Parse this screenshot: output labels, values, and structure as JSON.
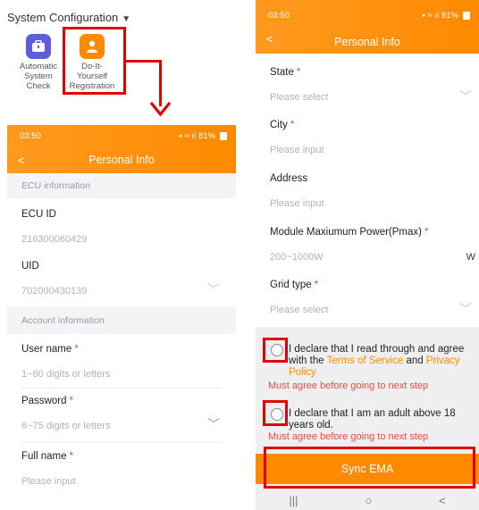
{
  "top": {
    "section_title": "System Configuration",
    "tiles": [
      {
        "label": "Automatic System Check",
        "icon": "briefcase-icon"
      },
      {
        "label": "Do-It-Yourself Registration",
        "icon": "person-icon"
      }
    ]
  },
  "left_phone": {
    "status": {
      "time": "03:50",
      "battery": "81%"
    },
    "nav": {
      "title": "Personal Info",
      "back": "<"
    },
    "ecu_section": "ECU information",
    "ecu_id": {
      "label": "ECU ID",
      "value": "216300060429"
    },
    "uid": {
      "label": "UID",
      "value": "702000430139"
    },
    "account_section": "Account information",
    "username": {
      "label": "User name",
      "required": "*",
      "placeholder": "1~60 digits or letters"
    },
    "password": {
      "label": "Password",
      "required": "*",
      "placeholder": "6~75 digits or letters"
    },
    "fullname": {
      "label": "Full name",
      "required": "*",
      "placeholder": "Please input"
    }
  },
  "right_phone": {
    "status": {
      "time": "03:50",
      "battery": "81%"
    },
    "nav": {
      "title": "Personal Info",
      "back": "<"
    },
    "state": {
      "label": "State",
      "required": "*",
      "placeholder": "Please select"
    },
    "city": {
      "label": "City",
      "required": "*",
      "placeholder": "Please input"
    },
    "address": {
      "label": "Address",
      "placeholder": "Please input"
    },
    "pmax": {
      "label": "Module Maxiumum Power(Pmax)",
      "required": "*",
      "placeholder": "200~1000W",
      "unit": "W"
    },
    "grid": {
      "label": "Grid type",
      "required": "*",
      "placeholder": "Please select"
    },
    "declaration1": {
      "text_a": "I declare that I read through and agree with the ",
      "link1": "Terms of Service",
      "text_b": " and ",
      "link2": "Privacy Policy",
      "warning": "Must agree before going to next step"
    },
    "declaration2": {
      "text": "I declare that I am an adult above 18 years old.",
      "warning": "Must agree before going to next step"
    },
    "sync_button": "Sync EMA",
    "system_nav": {
      "recents": "|||",
      "home": "○",
      "back": "<"
    }
  },
  "colors": {
    "accent": "#ff8a00",
    "highlight": "#e10000",
    "required": "#e74c3c"
  }
}
